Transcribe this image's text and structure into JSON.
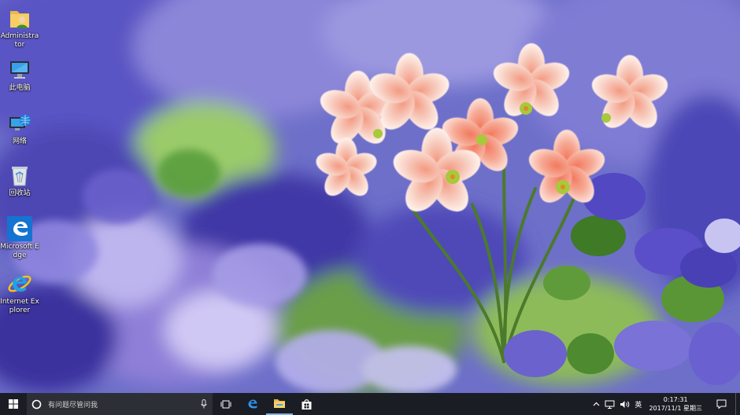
{
  "desktop": {
    "icons": [
      {
        "label": "Administrator",
        "icon": "user-folder-icon"
      },
      {
        "label": "此电脑",
        "icon": "computer-icon"
      },
      {
        "label": "网络",
        "icon": "network-icon"
      },
      {
        "label": "回收站",
        "icon": "recycle-bin-icon"
      },
      {
        "label": "Microsoft Edge",
        "icon": "edge-icon"
      },
      {
        "label": "Internet Explorer",
        "icon": "ie-icon"
      }
    ]
  },
  "taskbar": {
    "search_placeholder": "有问题尽管问我",
    "pinned": [
      {
        "name": "task-view",
        "icon": "task-view-icon"
      },
      {
        "name": "edge",
        "icon": "edge-icon"
      },
      {
        "name": "file-explorer",
        "icon": "folder-icon"
      },
      {
        "name": "store",
        "icon": "store-icon"
      }
    ],
    "tray": {
      "ime": "英",
      "time": "0:17:31",
      "date": "2017/11/1 星期三"
    }
  },
  "colors": {
    "taskbar_bg": "#1a1d24",
    "search_bg": "#2c2f36",
    "accent": "#1e7fd6"
  }
}
